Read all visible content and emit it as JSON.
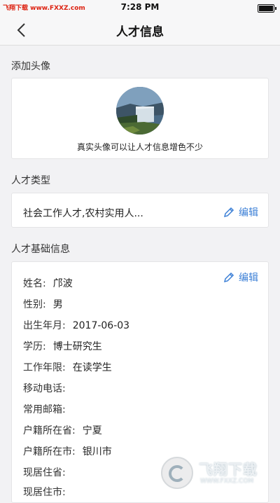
{
  "status": {
    "watermark": "飞翔下载 www.FXXZ.com",
    "time": "7:28 PM"
  },
  "nav": {
    "title": "人才信息"
  },
  "avatar_section": {
    "label": "添加头像",
    "caption": "真实头像可以让人才信息增色不少"
  },
  "type_section": {
    "label": "人才类型",
    "value": "社会工作人才,农村实用人...",
    "edit_label": "编辑"
  },
  "basic_section": {
    "label": "人才基础信息",
    "edit_label": "编辑",
    "rows": [
      {
        "key": "姓名:",
        "value": "邝波"
      },
      {
        "key": "性别:",
        "value": "男"
      },
      {
        "key": "出生年月:",
        "value": "2017-06-03"
      },
      {
        "key": "学历:",
        "value": "博士研究生"
      },
      {
        "key": "工作年限:",
        "value": "在读学生"
      },
      {
        "key": "移动电话:",
        "value": ""
      },
      {
        "key": "常用邮箱:",
        "value": ""
      },
      {
        "key": "户籍所在省:",
        "value": "宁夏"
      },
      {
        "key": "户籍所在市:",
        "value": "银川市"
      },
      {
        "key": "现居住省:",
        "value": ""
      },
      {
        "key": "现居住市:",
        "value": ""
      }
    ]
  },
  "watermark_bottom": {
    "name": "飞翔下载",
    "url": "WWW.FXXZ.COM"
  },
  "colors": {
    "accent": "#3b7fd6",
    "background": "#f2f2f4"
  }
}
